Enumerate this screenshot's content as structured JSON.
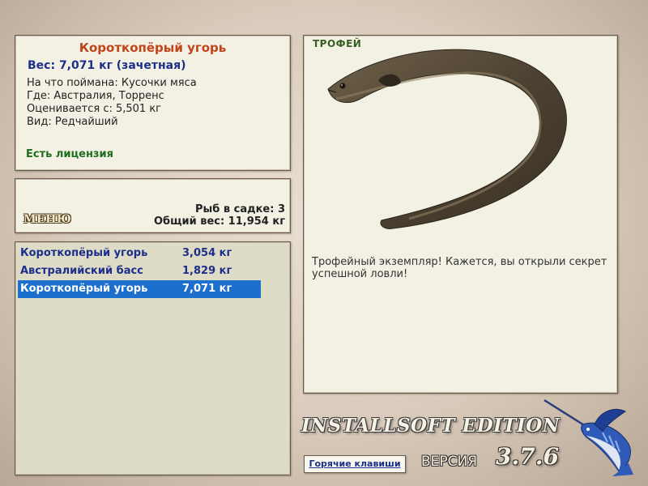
{
  "catch_info": {
    "fish_name": "Короткопёрый угорь",
    "weight_line": "Вес: 7,071 кг (зачетная)",
    "bait": "На что поймана: Кусочки мяса",
    "location": "Где: Австралия, Торренс",
    "scored_from": "Оценивается с: 5,501 кг",
    "rarity": "Вид: Редчайший",
    "license": "Есть лицензия"
  },
  "cage": {
    "menu_label": "МЕНЮ",
    "fish_count": "Рыб в садке: 3",
    "total_weight": "Общий вес: 11,954 кг"
  },
  "catch_list": {
    "selected_index": 2,
    "rows": [
      {
        "name": "Короткопёрый угорь",
        "weight": "3,054 кг"
      },
      {
        "name": "Австралийский басс",
        "weight": "1,829 кг"
      },
      {
        "name": "Короткопёрый угорь",
        "weight": "7,071 кг"
      }
    ]
  },
  "trophy": {
    "badge": "ТРОФЕЙ",
    "message": "Трофейный экземпляр! Кажется, вы открыли секрет успешной ловли!"
  },
  "footer": {
    "edition": "INSTALLSOFT EDITION",
    "version_label": "ВЕРСИЯ",
    "version_number": "3.7.6",
    "hotkeys_link": "Горячие клавиши"
  },
  "colors": {
    "panel_bg": "#f2f1e3",
    "list_bg": "#dedbc7",
    "fish_name": "#c2441a",
    "weight_blue": "#1d2f8a",
    "license_green": "#1f6e1f",
    "selection": "#1c6fcc"
  },
  "icons": {
    "trophy_image": "eel-image",
    "logo": "marlin-logo"
  }
}
